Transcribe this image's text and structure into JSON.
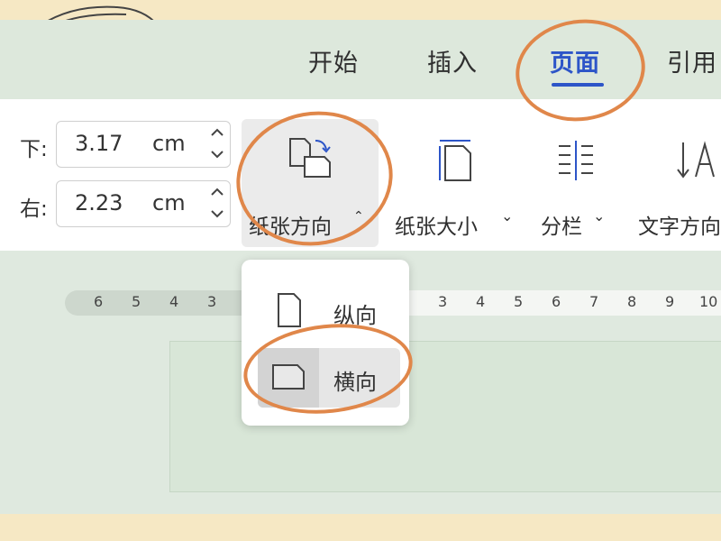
{
  "tabs": [
    {
      "label": "开始",
      "active": false
    },
    {
      "label": "插入",
      "active": false
    },
    {
      "label": "页面",
      "active": true
    },
    {
      "label": "引用",
      "active": false
    }
  ],
  "margins": {
    "bottom": {
      "label": "下:",
      "value": "3.17",
      "unit": "cm"
    },
    "right": {
      "label": "右:",
      "value": "2.23",
      "unit": "cm"
    }
  },
  "ribbon_buttons": {
    "orientation": {
      "label": "纸张方向",
      "caret": "⌃",
      "icon": "page-orientation-icon"
    },
    "size": {
      "label": "纸张大小",
      "caret": "⌄",
      "icon": "page-size-icon"
    },
    "columns": {
      "label": "分栏",
      "caret": "⌄",
      "icon": "columns-icon"
    },
    "text_direction": {
      "label": "文字方向",
      "icon": "text-direction-icon"
    }
  },
  "orientation_menu": {
    "items": [
      {
        "label": "纵向",
        "icon": "portrait-page-icon",
        "selected": false
      },
      {
        "label": "横向",
        "icon": "landscape-page-icon",
        "selected": true
      }
    ]
  },
  "ruler": {
    "left_ticks": [
      "6",
      "5",
      "4",
      "3"
    ],
    "right_ticks": [
      "3",
      "4",
      "5",
      "6",
      "7",
      "8",
      "9",
      "10"
    ]
  },
  "colors": {
    "accent": "#2d55c8",
    "annotation": "#e0874a",
    "workspace": "#dfe9df"
  }
}
